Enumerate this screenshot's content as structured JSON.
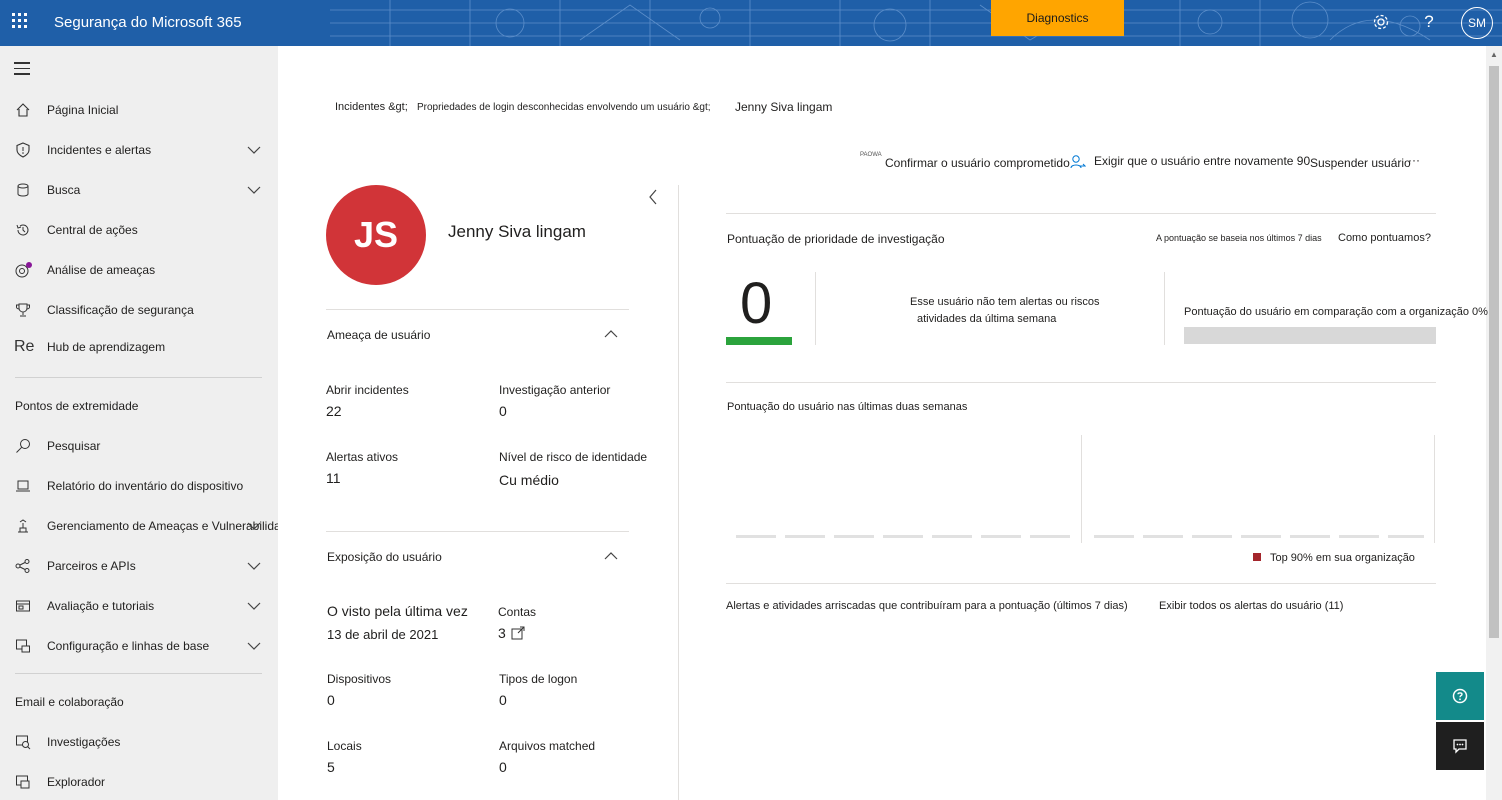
{
  "header": {
    "app_title": "Segurança do Microsoft 365",
    "diagnostics_label": "Diagnostics",
    "avatar_initials": "SM",
    "help_glyph": "?",
    "icons": [
      "waffle-icon",
      "gear-icon",
      "help-icon"
    ]
  },
  "sidebar": {
    "items_top": [
      {
        "label": "Página Inicial",
        "icon": "home-icon"
      },
      {
        "label": "Incidentes e alertas",
        "icon": "shield-icon",
        "expandable": true
      },
      {
        "label": "Busca",
        "icon": "hunting-icon",
        "expandable": true
      },
      {
        "label": "Central de ações",
        "icon": "history-icon"
      },
      {
        "label": "Análise de ameaças",
        "icon": "threat-analytics-icon"
      },
      {
        "label": "Classificação de segurança",
        "icon": "trophy-icon"
      },
      {
        "label": "Hub de aprendizagem",
        "icon_text": "Re"
      }
    ],
    "section_endpoints": "Pontos de extremidade",
    "items_endpoints": [
      {
        "label": "Pesquisar",
        "icon": "search-icon"
      },
      {
        "label": "Relatório do inventário do dispositivo",
        "icon": "laptop-icon"
      },
      {
        "label": "Gerenciamento de Ameaças e Vulnerabilidades",
        "icon": "tvm-icon",
        "expandable": true
      },
      {
        "label": "Parceiros e APIs",
        "icon": "partners-icon",
        "expandable": true
      },
      {
        "label": "Avaliação e tutoriais",
        "icon": "evaluation-icon",
        "expandable": true
      },
      {
        "label": "Configuração e linhas de base",
        "icon": "config-icon",
        "expandable": true
      }
    ],
    "section_email": "Email e colaboração",
    "items_email": [
      {
        "label": "Investigações",
        "icon": "investigations-icon"
      },
      {
        "label": "Explorador",
        "icon": "explorer-icon"
      }
    ],
    "accent_color": "#881798"
  },
  "breadcrumb": {
    "part1": "Incidentes &gt;",
    "part2": "Propriedades de login desconhecidas envolvendo um usuário &gt;",
    "part3": "Jenny Siva lingam"
  },
  "actions": {
    "small_label": "PAOWA",
    "confirm": "Confirmar o usuário comprometido",
    "require_signin": "Exigir que o usuário entre novamente 90",
    "suspend": "Suspender usuário",
    "more": "···"
  },
  "user": {
    "initials": "JS",
    "name": "Jenny Siva lingam",
    "avatar_color": "#d13438"
  },
  "threat": {
    "title": "Ameaça de usuário",
    "open_incidents_label": "Abrir incidentes",
    "open_incidents_value": "22",
    "prev_investigation_label": "Investigação anterior",
    "prev_investigation_value": "0",
    "active_alerts_label": "Alertas ativos",
    "active_alerts_value": "11",
    "identity_risk_label": "Nível de risco de identidade",
    "identity_risk_value": "Cu médio"
  },
  "exposure": {
    "title": "Exposição do usuário",
    "last_seen_label": "O visto pela última vez",
    "last_seen_value": "13 de abril de 2021",
    "accounts_label": "Contas",
    "accounts_value": "3",
    "devices_label": "Dispositivos",
    "devices_value": "0",
    "logon_types_label": "Tipos de logon",
    "logon_types_value": "0",
    "locations_label": "Locais",
    "locations_value": "5",
    "files_matched_label": "Arquivos matched",
    "files_matched_value": "0"
  },
  "priority": {
    "title": "Pontuação de prioridade de investigação",
    "based_on": "A pontuação se baseia nos últimos 7 dias",
    "how_we_score": "Como pontuamos?",
    "score": "0",
    "score_color": "#2ba33c",
    "no_alerts_line1": "Esse usuário não tem alertas ou riscos",
    "no_alerts_line2": "atividades da última semana",
    "comparison_label": "Pontuação do usuário em comparação com a organização 0%",
    "comparison_fraction": 0
  },
  "trend": {
    "title": "Pontuação do usuário nas últimas duas semanas",
    "legend": "Top 90% em sua organização",
    "legend_color": "#a4262c"
  },
  "contrib": {
    "title": "Alertas e atividades arriscadas que contribuíram para a pontuação (últimos 7 dias)",
    "view_all": "Exibir todos os alertas do usuário (11)"
  },
  "floating": {
    "help_icon": "question-circle-icon",
    "feedback_icon": "feedback-icon"
  }
}
